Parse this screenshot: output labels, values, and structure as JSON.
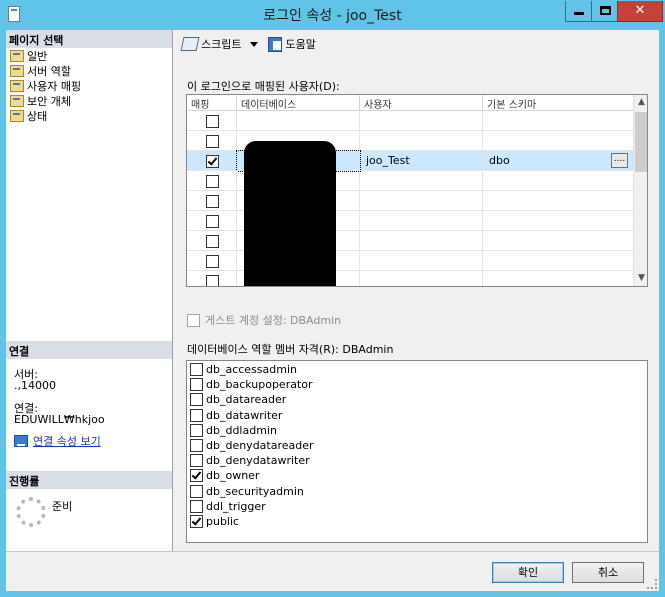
{
  "window": {
    "title": "로그인 속성 - joo_Test",
    "minimize_glyph": "",
    "close_glyph": "✕"
  },
  "left_panel": {
    "pages_header": "페이지 선택",
    "pages": [
      "일반",
      "서버 역할",
      "사용자 매핑",
      "보안 개체",
      "상태"
    ],
    "connection_header": "연결",
    "server_label": "서버:",
    "server_value": ".,14000",
    "connection_label": "연결:",
    "connection_value": "EDUWILL₩hkjoo",
    "view_connection_link": "연결 속성 보기",
    "progress_header": "진행률",
    "progress_status": "준비"
  },
  "toolbar": {
    "script_label": "스크립트",
    "help_label": "도움말"
  },
  "mapping": {
    "label": "이 로그인으로 매핑된 사용자(D):",
    "columns": [
      "매핑",
      "데이터베이스",
      "사용자",
      "기본 스키마"
    ],
    "rows": [
      {
        "mapped": false,
        "database": "",
        "user": "",
        "schema": ""
      },
      {
        "mapped": false,
        "database": "",
        "user": "",
        "schema": ""
      },
      {
        "mapped": true,
        "database": "",
        "user": "joo_Test",
        "schema": "dbo"
      },
      {
        "mapped": false,
        "database": "",
        "user": "",
        "schema": ""
      },
      {
        "mapped": false,
        "database": "",
        "user": "",
        "schema": ""
      },
      {
        "mapped": false,
        "database": "",
        "user": "",
        "schema": ""
      },
      {
        "mapped": false,
        "database": "",
        "user": "",
        "schema": ""
      },
      {
        "mapped": false,
        "database": "",
        "user": "",
        "schema": ""
      },
      {
        "mapped": false,
        "database": "",
        "user": "",
        "schema": ""
      }
    ],
    "ellipsis": "...."
  },
  "guest": {
    "label": "게스트 계정 설정: DBAdmin",
    "enabled": false
  },
  "roles": {
    "label": "데이터베이스 역할 멤버 자격(R): DBAdmin",
    "items": [
      {
        "name": "db_accessadmin",
        "checked": false
      },
      {
        "name": "db_backupoperator",
        "checked": false
      },
      {
        "name": "db_datareader",
        "checked": false
      },
      {
        "name": "db_datawriter",
        "checked": false
      },
      {
        "name": "db_ddladmin",
        "checked": false
      },
      {
        "name": "db_denydatareader",
        "checked": false
      },
      {
        "name": "db_denydatawriter",
        "checked": false
      },
      {
        "name": "db_owner",
        "checked": true
      },
      {
        "name": "db_securityadmin",
        "checked": false
      },
      {
        "name": "ddl_trigger",
        "checked": false
      },
      {
        "name": "public",
        "checked": true
      }
    ]
  },
  "buttons": {
    "ok": "확인",
    "cancel": "취소"
  }
}
